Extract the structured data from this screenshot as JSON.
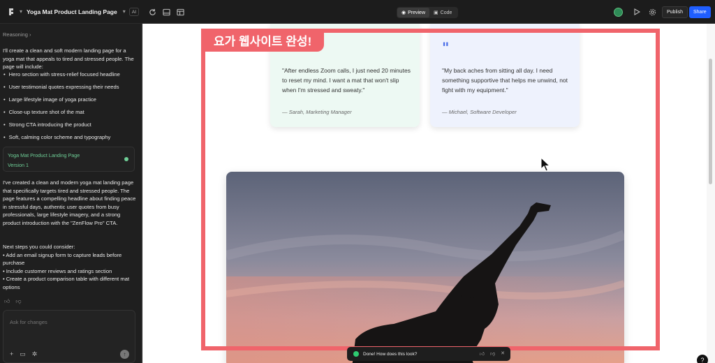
{
  "app": {
    "project_title": "Yoga Mat Product Landing Page",
    "ai_badge": "AI",
    "toggle": {
      "preview": "Preview",
      "code": "Code"
    },
    "publish": "Publish",
    "share": "Share",
    "help": "?"
  },
  "sidebar": {
    "reasoning": "Reasoning",
    "intro": "I'll create a clean and soft modern landing page for a yoga mat that appeals to tired and stressed people. The page will include:",
    "bullets": [
      "Hero section with stress-relief focused headline",
      "User testimonial quotes expressing their needs",
      "Large lifestyle image of yoga practice",
      "Close-up texture shot of the mat",
      "Strong CTA introducing the product",
      "Soft, calming color scheme and typography"
    ],
    "version_card": {
      "title": "Yoga Mat Product Landing Page",
      "version": "Version 1"
    },
    "summary": "I've created a clean and modern yoga mat landing page that specifically targets tired and stressed people. The page features a compelling headline about finding peace in stressful days, authentic user quotes from busy professionals, large lifestyle imagery, and a strong product introduction with the \"ZenFlow Pro\" CTA.",
    "next_steps_heading": "Next steps you could consider:",
    "next_steps": [
      "• Add an email signup form to capture leads before purchase",
      "• Include customer reviews and ratings section",
      "• Create a product comparison table with different mat options"
    ],
    "chat_placeholder": "Ask for changes"
  },
  "preview": {
    "testimonials": [
      {
        "quote": "\"After endless Zoom calls, I just need 20 minutes to reset my mind. I want a mat that won't slip when I'm stressed and sweaty.\"",
        "author": "— Sarah, Marketing Manager"
      },
      {
        "quote_mark": "\"",
        "quote": "\"My back aches from sitting all day. I need something supportive that helps me unwind, not fight with my equipment.\"",
        "author": "— Michael, Software Developer"
      }
    ],
    "overlay_label": "요가 웹사이트 완성!"
  },
  "toast": {
    "text": "Done! How does this look?"
  },
  "colors": {
    "accent": "#1f5eff",
    "highlight": "#f0646b",
    "success": "#6fcf97"
  }
}
